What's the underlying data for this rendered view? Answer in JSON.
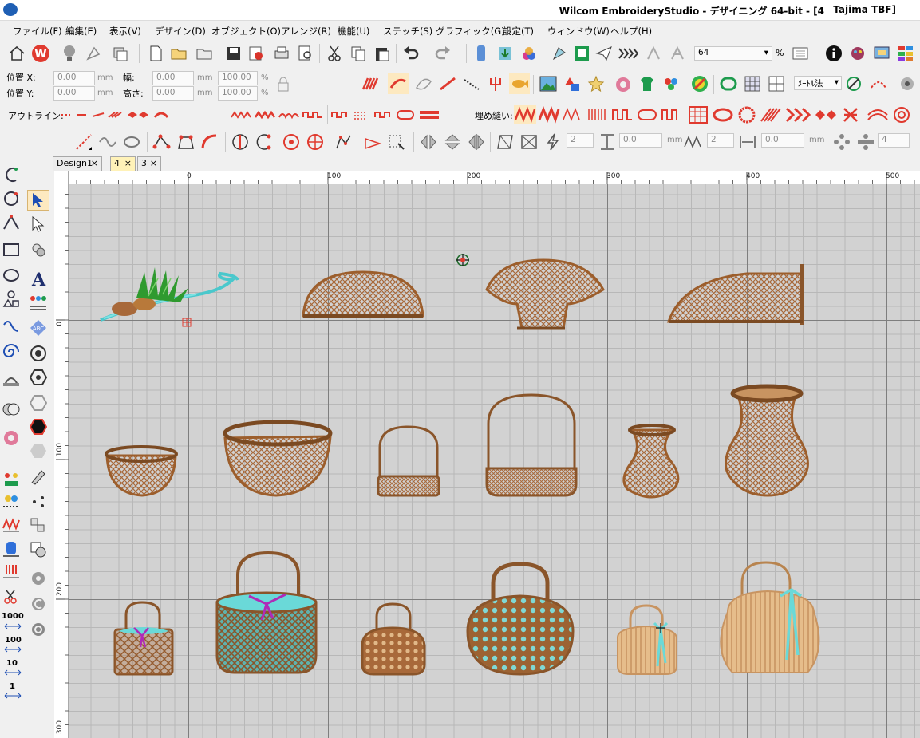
{
  "titlebar": {
    "title": "Wilcom EmbroideryStudio - デザイニング 64-bit - [4",
    "machine": "Tajima TBF]"
  },
  "menu": {
    "items": [
      "ファイル(F)",
      "編集(E)",
      "表示(V)",
      "デザイン(D)",
      "オブジェクト(O)",
      "アレンジ(R)",
      "機能(U)",
      "ステッチ(S)",
      "グラフィック(G)",
      "設定(T)",
      "ウィンドウ(W)",
      "ヘルプ(H)"
    ]
  },
  "toolbar": {
    "zoom_value": "64",
    "zoom_unit": "%"
  },
  "props": {
    "pos_x_label": "位置 X:",
    "pos_y_label": "位置 Y:",
    "width_label": "幅:",
    "height_label": "高さ:",
    "pos_x": "0.00",
    "pos_y": "0.00",
    "width": "0.00",
    "height": "0.00",
    "scale_w": "100.00",
    "scale_h": "100.00",
    "unit_mm": "mm",
    "unit_pct": "%",
    "measure_select": "ﾒｰﾄﾙ法"
  },
  "outline_bar": {
    "label": "アウトライン:",
    "fill_label": "埋め縫い:"
  },
  "edit_bar": {
    "f1": "2",
    "f2": "0.0",
    "f3": "2",
    "f4": "0.0",
    "f5": "4",
    "unit": "mm"
  },
  "tabs": [
    {
      "label": "Design1",
      "close": "×"
    },
    {
      "label": "4",
      "close": "×"
    },
    {
      "label": "3",
      "close": "×"
    }
  ],
  "ruler": {
    "top": [
      "0",
      "100",
      "200",
      "300",
      "400",
      "500"
    ],
    "left": [
      "0",
      "100",
      "200",
      "300"
    ]
  },
  "toolbox": {
    "zoom_labels": [
      "1000",
      "100",
      "10",
      "1"
    ]
  },
  "colors": {
    "basket": "#a8693a",
    "basket_dark": "#7b4a22",
    "basket_light": "#e1b888",
    "aqua": "#6ad9d8",
    "magenta": "#b02ab8",
    "leaf": "#3aa63a"
  }
}
